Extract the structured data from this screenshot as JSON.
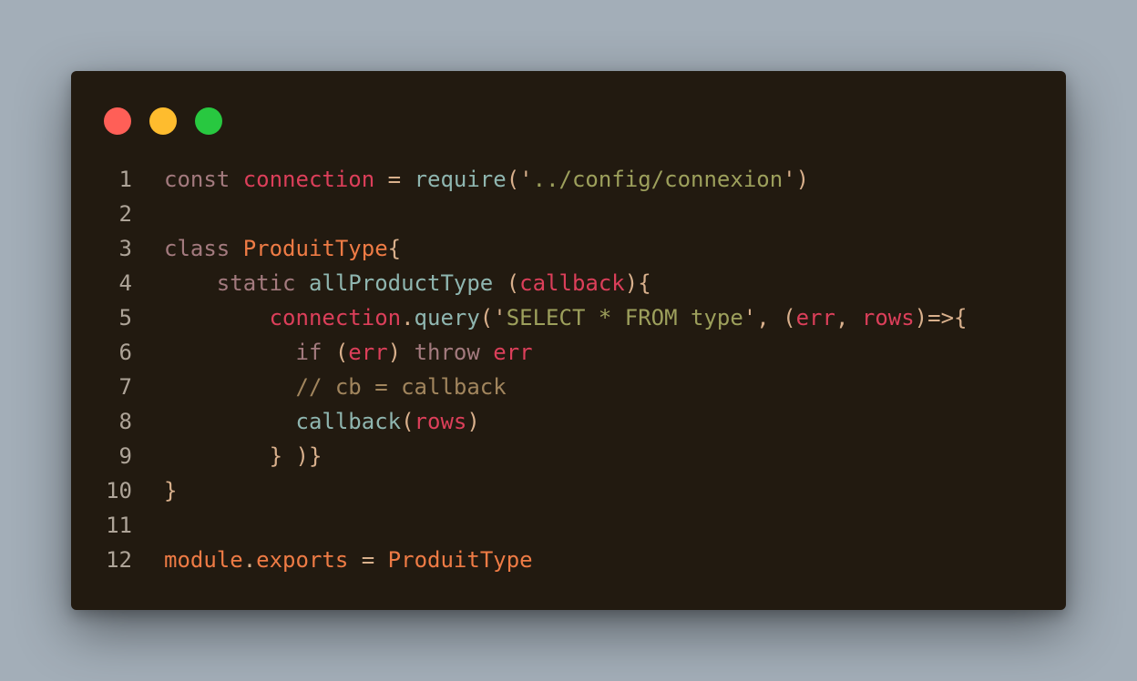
{
  "window": {
    "controls": [
      {
        "name": "close",
        "color": "#ff5f57"
      },
      {
        "name": "minimize",
        "color": "#febc2e"
      },
      {
        "name": "zoom",
        "color": "#28c840"
      }
    ]
  },
  "colors": {
    "keyword": "#a37a7e",
    "variable": "#dc3f5a",
    "operator": "#d9b08c",
    "function": "#8fb6b0",
    "string": "#9da05c",
    "class": "#ee7b45",
    "comment": "#a1855d",
    "line_number": "#aea498"
  },
  "code": {
    "lines": [
      {
        "number": "1",
        "tokens": [
          {
            "text": "const ",
            "kind": "keyword"
          },
          {
            "text": "connection",
            "kind": "variable"
          },
          {
            "text": " = ",
            "kind": "operator"
          },
          {
            "text": "require",
            "kind": "function"
          },
          {
            "text": "(",
            "kind": "operator"
          },
          {
            "text": "'",
            "kind": "operator"
          },
          {
            "text": "../config/connexion",
            "kind": "string"
          },
          {
            "text": "'",
            "kind": "operator"
          },
          {
            "text": ")",
            "kind": "operator"
          }
        ]
      },
      {
        "number": "2",
        "tokens": []
      },
      {
        "number": "3",
        "tokens": [
          {
            "text": "class ",
            "kind": "keyword"
          },
          {
            "text": "ProduitType",
            "kind": "class"
          },
          {
            "text": "{",
            "kind": "operator"
          }
        ]
      },
      {
        "number": "4",
        "tokens": [
          {
            "text": "    static ",
            "kind": "keyword"
          },
          {
            "text": "allProductType",
            "kind": "function"
          },
          {
            "text": " (",
            "kind": "operator"
          },
          {
            "text": "callback",
            "kind": "variable"
          },
          {
            "text": "){",
            "kind": "operator"
          }
        ]
      },
      {
        "number": "5",
        "tokens": [
          {
            "text": "        ",
            "kind": "operator"
          },
          {
            "text": "connection",
            "kind": "variable"
          },
          {
            "text": ".",
            "kind": "operator"
          },
          {
            "text": "query",
            "kind": "function"
          },
          {
            "text": "(",
            "kind": "operator"
          },
          {
            "text": "'",
            "kind": "operator"
          },
          {
            "text": "SELECT * FROM type",
            "kind": "string"
          },
          {
            "text": "'",
            "kind": "operator"
          },
          {
            "text": ", (",
            "kind": "operator"
          },
          {
            "text": "err",
            "kind": "variable"
          },
          {
            "text": ", ",
            "kind": "operator"
          },
          {
            "text": "rows",
            "kind": "variable"
          },
          {
            "text": ")=>{",
            "kind": "operator"
          }
        ]
      },
      {
        "number": "6",
        "tokens": [
          {
            "text": "          if ",
            "kind": "keyword"
          },
          {
            "text": "(",
            "kind": "operator"
          },
          {
            "text": "err",
            "kind": "variable"
          },
          {
            "text": ") ",
            "kind": "operator"
          },
          {
            "text": "throw ",
            "kind": "keyword"
          },
          {
            "text": "err",
            "kind": "variable"
          }
        ]
      },
      {
        "number": "7",
        "tokens": [
          {
            "text": "          // cb = callback",
            "kind": "comment"
          }
        ]
      },
      {
        "number": "8",
        "tokens": [
          {
            "text": "          ",
            "kind": "operator"
          },
          {
            "text": "callback",
            "kind": "function"
          },
          {
            "text": "(",
            "kind": "operator"
          },
          {
            "text": "rows",
            "kind": "variable"
          },
          {
            "text": ")",
            "kind": "operator"
          }
        ]
      },
      {
        "number": "9",
        "tokens": [
          {
            "text": "        } )}",
            "kind": "operator"
          }
        ]
      },
      {
        "number": "10",
        "tokens": [
          {
            "text": "}",
            "kind": "operator"
          }
        ]
      },
      {
        "number": "11",
        "tokens": []
      },
      {
        "number": "12",
        "tokens": [
          {
            "text": "module",
            "kind": "class"
          },
          {
            "text": ".",
            "kind": "operator"
          },
          {
            "text": "exports",
            "kind": "class"
          },
          {
            "text": " = ",
            "kind": "operator"
          },
          {
            "text": "ProduitType",
            "kind": "class"
          }
        ]
      }
    ]
  }
}
